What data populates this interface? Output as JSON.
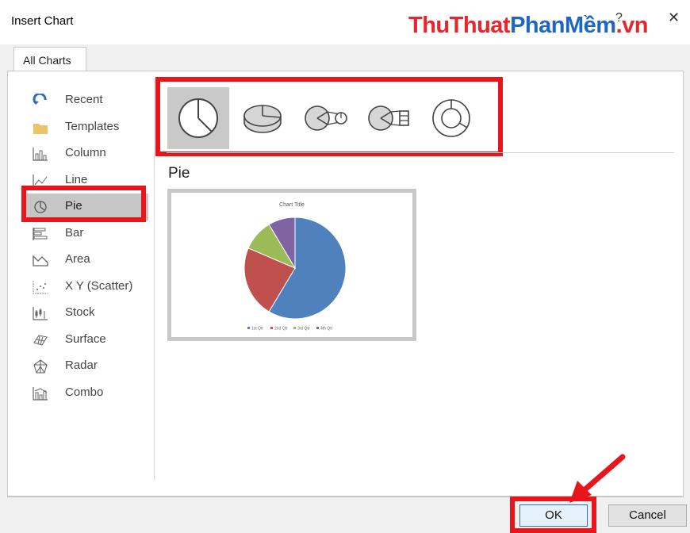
{
  "dialog": {
    "title": "Insert Chart",
    "help": "?",
    "close": "✕"
  },
  "watermark": {
    "part1": "ThuThuat",
    "part2": "PhanMềm",
    "part3": ".vn"
  },
  "tab": {
    "label": "All Charts"
  },
  "sidebar": {
    "items": [
      {
        "label": "Recent",
        "icon": "recent-icon"
      },
      {
        "label": "Templates",
        "icon": "folder-icon"
      },
      {
        "label": "Column",
        "icon": "column-chart-icon"
      },
      {
        "label": "Line",
        "icon": "line-chart-icon"
      },
      {
        "label": "Pie",
        "icon": "pie-chart-icon",
        "selected": true
      },
      {
        "label": "Bar",
        "icon": "bar-chart-icon"
      },
      {
        "label": "Area",
        "icon": "area-chart-icon"
      },
      {
        "label": "X Y (Scatter)",
        "icon": "scatter-chart-icon"
      },
      {
        "label": "Stock",
        "icon": "stock-chart-icon"
      },
      {
        "label": "Surface",
        "icon": "surface-chart-icon"
      },
      {
        "label": "Radar",
        "icon": "radar-chart-icon"
      },
      {
        "label": "Combo",
        "icon": "combo-chart-icon"
      }
    ]
  },
  "subtypes": [
    "pie",
    "3d-pie",
    "pie-of-pie",
    "bar-of-pie",
    "doughnut"
  ],
  "selected_chart": {
    "name": "Pie"
  },
  "preview": {
    "chart_data": {
      "type": "pie",
      "title": "Chart Title",
      "categories": [
        "1st Qtr",
        "2nd Qtr",
        "3rd Qtr",
        "4th Qtr"
      ],
      "values": [
        8.2,
        3.2,
        1.4,
        1.2
      ],
      "colors": [
        "#4f81bd",
        "#c0504d",
        "#9bbb59",
        "#8064a2"
      ]
    }
  },
  "buttons": {
    "ok": "OK",
    "cancel": "Cancel"
  },
  "colors": {
    "highlight": "#e8151c",
    "selection": "#c6c6c6"
  }
}
